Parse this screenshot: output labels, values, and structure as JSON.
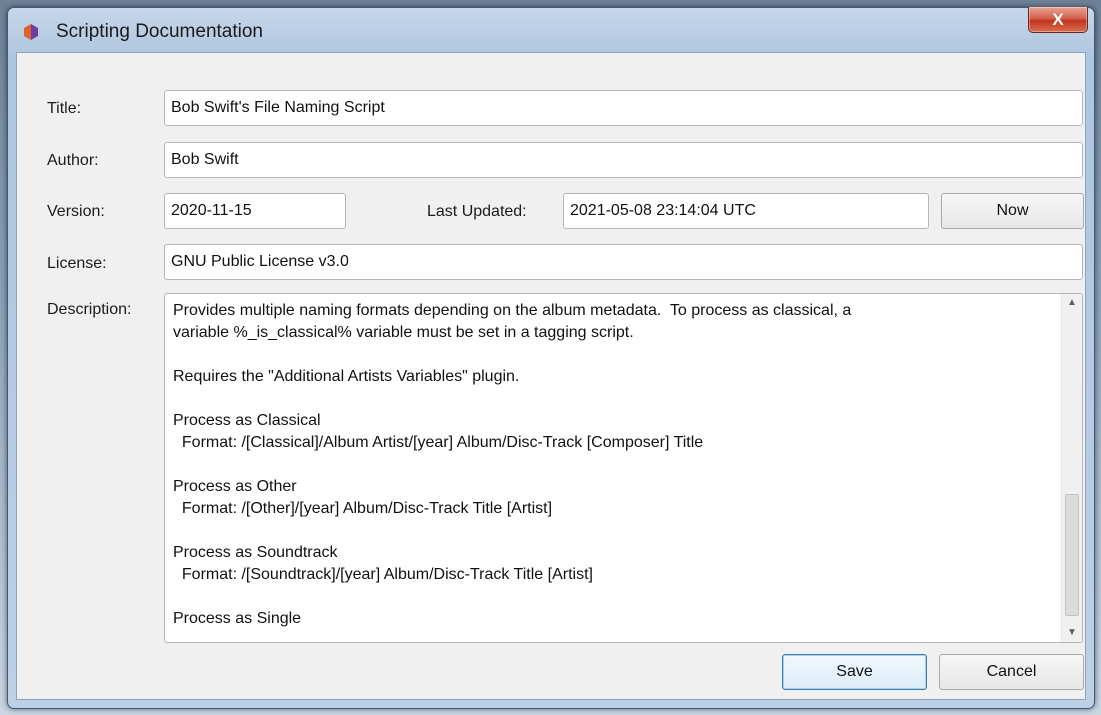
{
  "window": {
    "title": "Scripting Documentation",
    "close_label": "X"
  },
  "form": {
    "title_label": "Title:",
    "title_value": "Bob Swift's File Naming Script",
    "author_label": "Author:",
    "author_value": "Bob Swift",
    "version_label": "Version:",
    "version_value": "2020-11-15",
    "last_updated_label": "Last Updated:",
    "last_updated_value": "2021-05-08 23:14:04 UTC",
    "now_label": "Now",
    "license_label": "License:",
    "license_value": "GNU Public License v3.0",
    "description_label": "Description:",
    "description_lines": [
      "Provides multiple naming formats depending on the album metadata.  To process as classical, a",
      "variable %_is_classical% variable must be set in a tagging script.",
      "",
      "Requires the \"Additional Artists Variables\" plugin.",
      "",
      "Process as Classical",
      "  Format: /[Classical]/Album Artist/[year] Album/Disc-Track [Composer] Title",
      "",
      "Process as Other",
      "  Format: /[Other]/[year] Album/Disc-Track Title [Artist]",
      "",
      "Process as Soundtrack",
      "  Format: /[Soundtrack]/[year] Album/Disc-Track Title [Artist]",
      "",
      "Process as Single"
    ]
  },
  "buttons": {
    "save_label": "Save",
    "cancel_label": "Cancel"
  },
  "icons": {
    "app": "picard-logo-icon",
    "scroll_up": "arrow-up-icon",
    "scroll_down": "arrow-down-icon"
  },
  "colors": {
    "logo_left": "#e0612a",
    "logo_right": "#6b3fa0",
    "default_button_border": "#3c7fb1",
    "close_button": "#c1361f"
  }
}
